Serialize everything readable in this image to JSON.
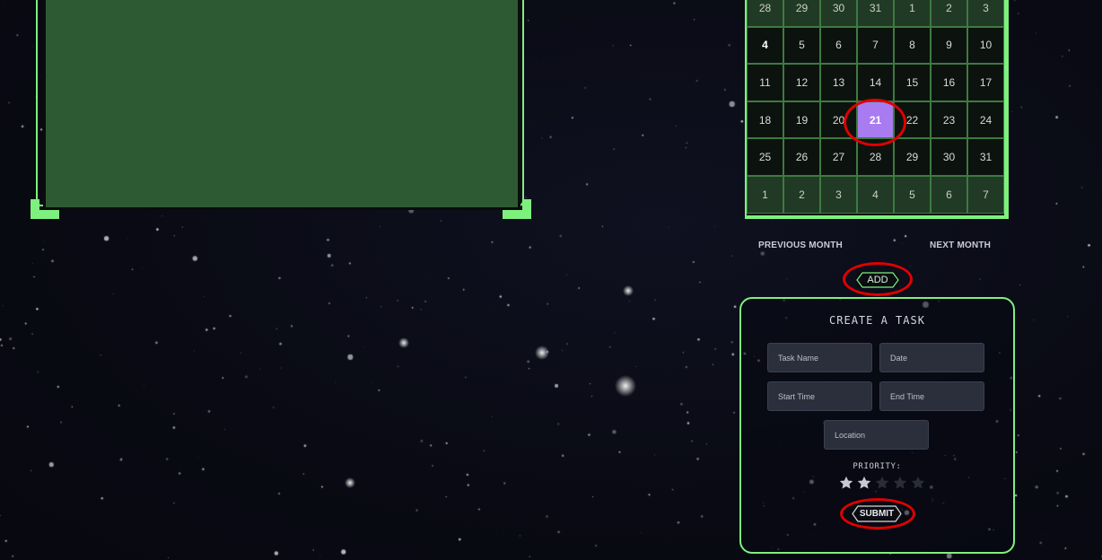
{
  "calendar": {
    "weeks": [
      [
        {
          "d": "28",
          "muted": true
        },
        {
          "d": "29",
          "muted": true
        },
        {
          "d": "30",
          "muted": true
        },
        {
          "d": "31",
          "muted": true
        },
        {
          "d": "1",
          "muted": true
        },
        {
          "d": "2",
          "muted": true
        },
        {
          "d": "3",
          "muted": true
        }
      ],
      [
        {
          "d": "4",
          "today": true
        },
        {
          "d": "5"
        },
        {
          "d": "6"
        },
        {
          "d": "7"
        },
        {
          "d": "8"
        },
        {
          "d": "9"
        },
        {
          "d": "10"
        }
      ],
      [
        {
          "d": "11"
        },
        {
          "d": "12"
        },
        {
          "d": "13"
        },
        {
          "d": "14"
        },
        {
          "d": "15"
        },
        {
          "d": "16"
        },
        {
          "d": "17"
        }
      ],
      [
        {
          "d": "18"
        },
        {
          "d": "19"
        },
        {
          "d": "20"
        },
        {
          "d": "21",
          "selected": true
        },
        {
          "d": "22"
        },
        {
          "d": "23"
        },
        {
          "d": "24"
        }
      ],
      [
        {
          "d": "25"
        },
        {
          "d": "26"
        },
        {
          "d": "27"
        },
        {
          "d": "28"
        },
        {
          "d": "29"
        },
        {
          "d": "30"
        },
        {
          "d": "31"
        }
      ],
      [
        {
          "d": "1",
          "muted": true
        },
        {
          "d": "2",
          "muted": true
        },
        {
          "d": "3",
          "muted": true
        },
        {
          "d": "4",
          "muted": true
        },
        {
          "d": "5",
          "muted": true
        },
        {
          "d": "6",
          "muted": true
        },
        {
          "d": "7",
          "muted": true
        }
      ]
    ],
    "prev_label": "PREVIOUS MONTH",
    "next_label": "NEXT MONTH"
  },
  "add_button": {
    "label": "ADD"
  },
  "task_form": {
    "title": "CREATE A TASK",
    "task_name_placeholder": "Task Name",
    "date_placeholder": "Date",
    "start_time_placeholder": "Start Time",
    "end_time_placeholder": "End Time",
    "location_placeholder": "Location",
    "priority_label": "PRIORITY:",
    "priority_rating": 2,
    "priority_max": 5,
    "submit_label": "SUBMIT"
  },
  "colors": {
    "accent_green": "#7ef07e",
    "panel_green": "#2e5a33",
    "selected_day": "#a87cf0",
    "highlight_ring": "#e00000",
    "star_active": "#c7cad3",
    "star_inactive": "#2a2d38"
  },
  "icons": {
    "star": "star-icon"
  }
}
